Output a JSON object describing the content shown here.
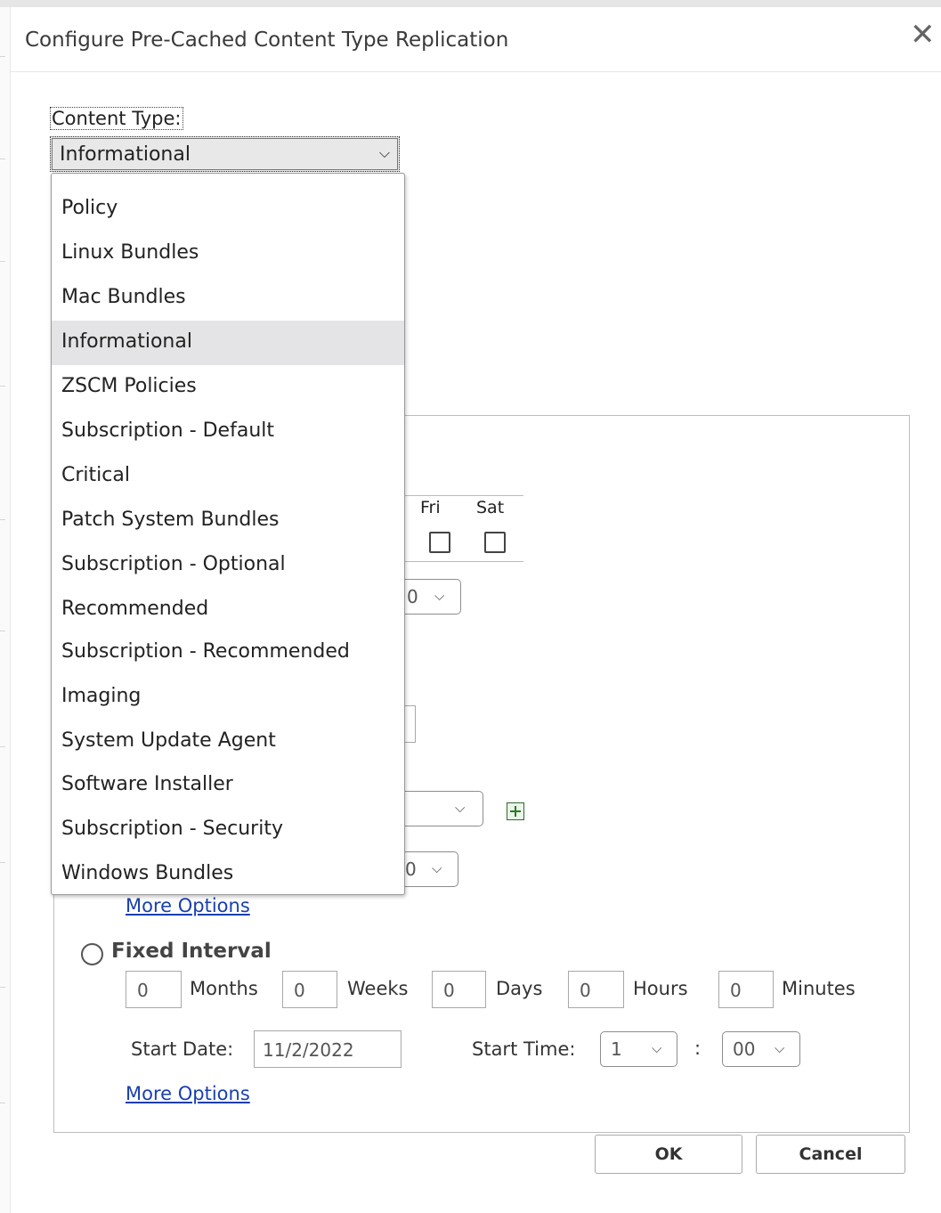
{
  "dialog": {
    "title": "Configure Pre-Cached Content Type Replication"
  },
  "content_type": {
    "label": "Content Type:",
    "selected": "Informational",
    "options": [
      "Policy",
      "Linux Bundles",
      "Mac Bundles",
      "Informational",
      "ZSCM Policies",
      "Subscription - Default",
      "Critical",
      "Patch System Bundles",
      "Subscription - Optional",
      "Recommended",
      "Subscription - Recommended",
      "Imaging",
      "System Update Agent",
      "Software Installer",
      "Subscription - Security",
      "Windows Bundles"
    ]
  },
  "days": {
    "fri": "Fri",
    "sat": "Sat"
  },
  "partial_selects": {
    "day_minute": "0",
    "second_minute": "0"
  },
  "event_section": {
    "more_options": "More Options"
  },
  "fixed_interval": {
    "label": "Fixed Interval",
    "months_value": "0",
    "months_label": "Months",
    "weeks_value": "0",
    "weeks_label": "Weeks",
    "days_value": "0",
    "days_label": "Days",
    "hours_value": "0",
    "hours_label": "Hours",
    "minutes_value": "0",
    "minutes_label": "Minutes",
    "start_date_label": "Start Date:",
    "start_date_value": "11/2/2022",
    "start_time_label": "Start Time:",
    "start_hour": "1",
    "time_separator": ":",
    "start_minute": "00",
    "more_options": "More Options"
  },
  "buttons": {
    "ok": "OK",
    "cancel": "Cancel"
  }
}
